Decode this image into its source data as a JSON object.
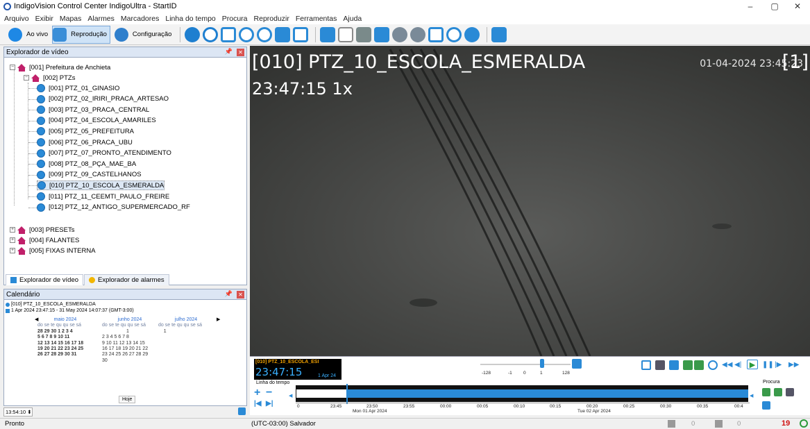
{
  "window": {
    "title": "IndigoVision Control Center IndigoUltra - StartID",
    "minimize": "–",
    "maximize": "▢",
    "close": "✕"
  },
  "menu": [
    "Arquivo",
    "Exibir",
    "Mapas",
    "Alarmes",
    "Marcadores",
    "Linha do tempo",
    "Procura",
    "Reproduzir",
    "Ferramentas",
    "Ajuda"
  ],
  "toolbar": {
    "live_label": "Ao vivo",
    "playback_label": "Reprodução",
    "config_label": "Configuração"
  },
  "explorer": {
    "title": "Explorador de vídeo",
    "root": "[001] Prefeitura de Anchieta",
    "group": "[002] PTZs",
    "cameras": [
      "[001] PTZ_01_GINASIO",
      "[002] PTZ_02_IRIRI_PRACA_ARTESAO",
      "[003] PTZ_03_PRACA_CENTRAL",
      "[004] PTZ_04_ESCOLA_AMARILES",
      "[005] PTZ_05_PREFEITURA",
      "[006] PTZ_06_PRACA_UBU",
      "[007] PTZ_07_PRONTO_ATENDIMENTO",
      "[008] PTZ_08_PÇA_MAE_BA",
      "[009] PTZ_09_CASTELHANOS",
      "[010] PTZ_10_ESCOLA_ESMERALDA",
      "[011] PTZ_11_CEEMTI_PAULO_FREIRE",
      "[012] PTZ_12_ANTIGO_SUPERMERCADO_RF"
    ],
    "others": [
      "[003] PRESETs",
      "[004] FALANTES",
      "[005] FIXAS INTERNA"
    ],
    "tab_video": "Explorador de vídeo",
    "tab_alarms": "Explorador de alarmes"
  },
  "calendar": {
    "title": "Calendário",
    "camera": "[010] PTZ_10_ESCOLA_ESMERALDA",
    "range": "1 Apr 2024 23:47:15 - 31 May 2024 14:07:37 (GMT-3:00)",
    "months": [
      {
        "name": "maio 2024",
        "days_header": "do se te qu qu se sá",
        "rows": [
          "28 29 30  1  2  3  4",
          " 5  6  7  8  9 10 11",
          "12 13 14 15 16 17 18",
          "19 20 21 22 23 24 25",
          "26 27 28 29 30 31"
        ]
      },
      {
        "name": "junho 2024",
        "days_header": "do se te qu qu se sá",
        "rows": [
          "                  1",
          " 2  3  4  5  6  7  8",
          " 9 10 11 12 13 14 15",
          "16 17 18 19 20 21 22",
          "23 24 25 26 27 28 29",
          "30"
        ]
      },
      {
        "name": "julho 2024",
        "days_header": "do se te qu qu se sá",
        "rows": [
          "    1"
        ]
      }
    ],
    "today_button": "Hoje",
    "time_value": "13:54:10"
  },
  "video": {
    "camera_title": "[010] PTZ_10_ESCOLA_ESMERALDA",
    "tile_number": "[1]",
    "time_speed": "23:47:15 1x",
    "datetime": "01-04-2024 23:45:23"
  },
  "playback": {
    "cam_label": "[010] PTZ_10_ESCOLA_ESI",
    "time": "23:47:15",
    "date": "1 Apr 24",
    "speed_ticks": [
      "-128",
      "-1",
      "0",
      "1",
      "128"
    ],
    "timeline_label": "Linha do tempo",
    "ticks": [
      "0",
      "23:45",
      "23:50",
      "23:55",
      "00:00",
      "00:05",
      "00:10",
      "00:15",
      "00:20",
      "00:25",
      "00:30",
      "00:35",
      "00:4"
    ],
    "date_left": "Mon 01 Apr 2024",
    "date_right": "Tue 02 Apr 2024",
    "search_label": "Procura"
  },
  "status": {
    "ready": "Pronto",
    "timezone": "(UTC-03:00) Salvador",
    "count1": "0",
    "count2": "0",
    "alarm_count": "19"
  }
}
